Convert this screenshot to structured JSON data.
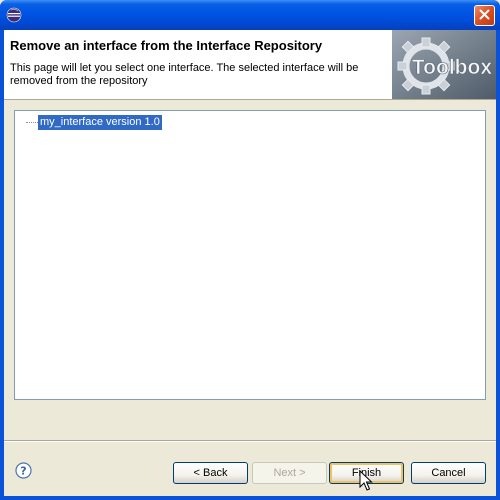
{
  "window": {
    "title": "",
    "icon": "eclipse-icon",
    "close_icon": "close-icon"
  },
  "banner": {
    "title": "Remove an interface from the Interface Repository",
    "description": "This page will let you select one interface. The selected interface will be removed from the repository",
    "logo_text": "Toolbox",
    "logo_icon": "gear-icon"
  },
  "tree": {
    "items": [
      {
        "label": "my_interface version 1.0",
        "selected": true
      }
    ]
  },
  "footer": {
    "help_icon": "help-icon",
    "back_label": "< Back",
    "next_label": "Next >",
    "finish_label": "Finish",
    "cancel_label": "Cancel"
  },
  "colors": {
    "titlebar": "#0054e3",
    "selection": "#316ac5",
    "dialog_bg": "#ece9d8"
  }
}
